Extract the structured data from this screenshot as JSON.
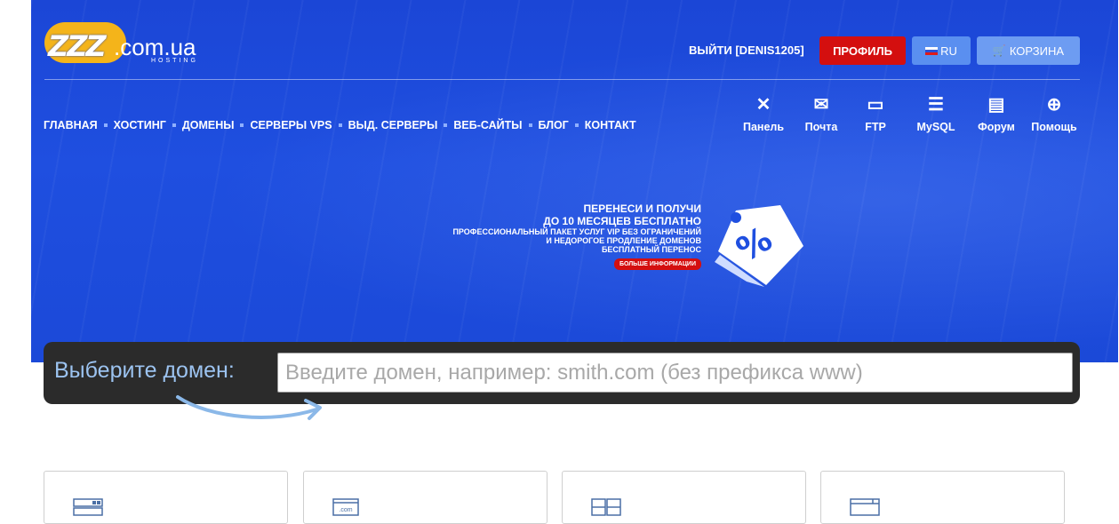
{
  "logo": {
    "mark": "ZZZ",
    "domain": ".com.ua",
    "sub": "HOSTING"
  },
  "header": {
    "logout": "ВЫЙТИ [DENIS1205]",
    "profile": "ПРОФИЛЬ",
    "language": "RU",
    "cart": "КОРЗИНА"
  },
  "nav": {
    "items": [
      "ГЛАВНАЯ",
      "ХОСТИНГ",
      "ДОМЕНЫ",
      "СЕРВЕРЫ VPS",
      "ВЫД. СЕРВЕРЫ",
      "ВЕБ-САЙТЫ",
      "БЛОГ",
      "КОНТАКТ"
    ]
  },
  "tools": [
    {
      "label": "Панель",
      "icon": "tools-icon"
    },
    {
      "label": "Почта",
      "icon": "mail-icon"
    },
    {
      "label": "FTP",
      "icon": "ftp-folder-icon"
    },
    {
      "label": "MySQL",
      "icon": "database-icon"
    },
    {
      "label": "Форум",
      "icon": "forum-icon"
    },
    {
      "label": "Помощь",
      "icon": "lifebuoy-icon"
    }
  ],
  "promo": {
    "line1": "ПЕРЕНЕСИ И ПОЛУЧИ",
    "line2": "ДО 10 МЕСЯЦЕВ БЕСПЛАТНО",
    "line3": "ПРОФЕССИОНАЛЬНЫЙ ПАКЕТ УСЛУГ VIP БЕЗ ОГРАНИЧЕНИЙ",
    "line4": "И НЕДОРОГОЕ ПРОДЛЕНИЕ ДОМЕНОВ",
    "line5": "БЕСПЛАТНЫЙ ПЕРЕНОС",
    "more": "БОЛЬШЕ ИНФОРМАЦИИ",
    "tag_text": "%"
  },
  "search": {
    "label": "Выберите домен:",
    "placeholder": "Введите домен, например: smith.com (без префикса www)"
  },
  "cards": [
    {
      "icon": "server-icon"
    },
    {
      "icon": "domain-com-icon",
      "icon_text": ".com"
    },
    {
      "icon": "windows-icon"
    },
    {
      "icon": "browser-window-icon"
    }
  ],
  "colors": {
    "hero_blue": "#1f4fe0",
    "profile_red": "#d40f0f",
    "lang_blue": "#5a8ff0",
    "cart_blue": "#6d9cf2",
    "search_bg": "#2b2b2b",
    "logo_gold": "#f4b41a"
  }
}
